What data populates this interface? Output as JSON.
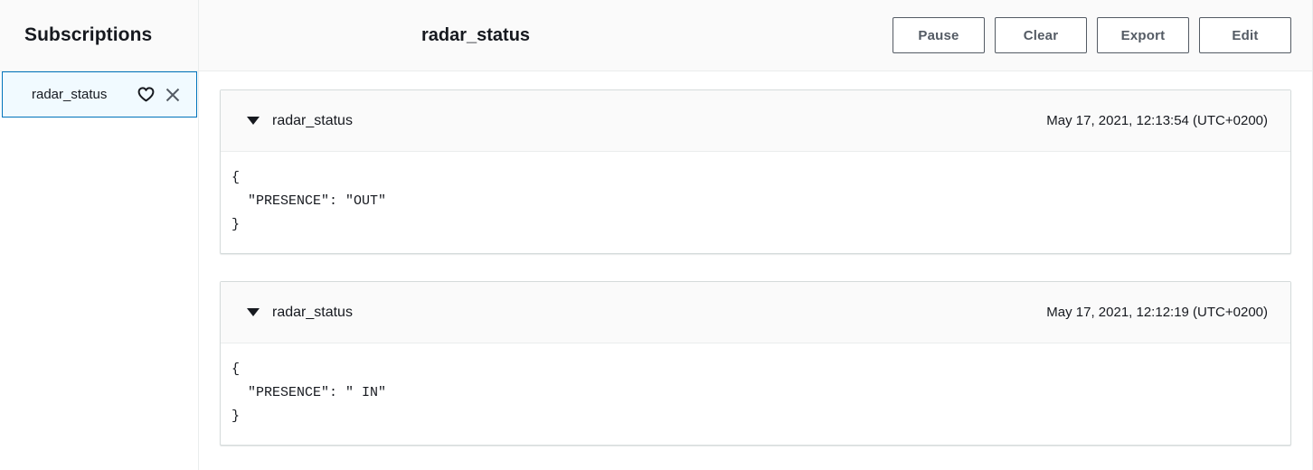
{
  "sidebar": {
    "title": "Subscriptions",
    "items": [
      {
        "label": "radar_status",
        "favorite_icon": "heart-icon",
        "close_icon": "close-icon",
        "selected": true
      }
    ]
  },
  "header": {
    "title": "radar_status",
    "buttons": [
      {
        "label": "Pause",
        "name": "pause-button"
      },
      {
        "label": "Clear",
        "name": "clear-button"
      },
      {
        "label": "Export",
        "name": "export-button"
      },
      {
        "label": "Edit",
        "name": "edit-button"
      }
    ]
  },
  "messages": [
    {
      "topic": "radar_status",
      "timestamp": "May 17, 2021, 12:13:54 (UTC+0200)",
      "expanded": true,
      "payload": "{\n  \"PRESENCE\": \"OUT\"\n}"
    },
    {
      "topic": "radar_status",
      "timestamp": "May 17, 2021, 12:12:19 (UTC+0200)",
      "expanded": true,
      "payload": "{\n  \"PRESENCE\": \" IN\"\n}"
    }
  ],
  "colors": {
    "accent": "#0073bb",
    "selected_bg": "#f1faff",
    "header_bg": "#fafafa",
    "border": "#d5dbdb",
    "text": "#16191f",
    "button_text": "#545b64"
  }
}
